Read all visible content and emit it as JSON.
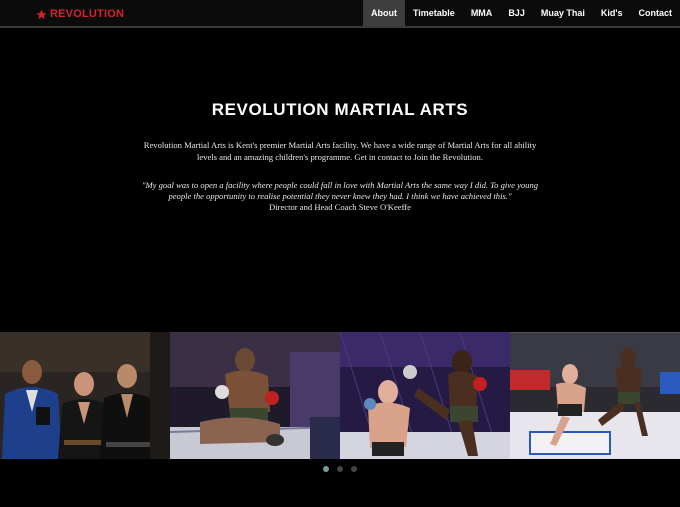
{
  "brand": {
    "name": "REVOLUTION",
    "color": "#d8232a",
    "icon": "star-icon"
  },
  "nav": {
    "items": [
      {
        "label": "About",
        "active": true
      },
      {
        "label": "Timetable",
        "active": false
      },
      {
        "label": "MMA",
        "active": false
      },
      {
        "label": "BJJ",
        "active": false
      },
      {
        "label": "Muay Thai",
        "active": false
      },
      {
        "label": "Kid's",
        "active": false
      },
      {
        "label": "Contact",
        "active": false
      }
    ]
  },
  "hero": {
    "title": "REVOLUTION MARTIAL ARTS",
    "description": "Revolution Martial Arts is Kent's premier Martial Arts facility. We have a wide range of Martial Arts for all ability levels and an amazing children's programme. Get in contact to Join the Revolution.",
    "quote": "\"My goal was to open a facility where people could fall in love with Martial Arts the same way I did. To give young people the opportunity to realise potential they never knew they had. I think we have achieved this.\"",
    "attribution": "Director and Head Coach Steve O'Keeffe"
  },
  "gallery": {
    "photos": [
      {
        "subject": "three-coaches-photo"
      },
      {
        "subject": "ground-fight-photo"
      },
      {
        "subject": "kick-fight-photo"
      },
      {
        "subject": "cage-fight-photo"
      }
    ]
  },
  "carousel": {
    "total": 3,
    "active_index": 0
  }
}
